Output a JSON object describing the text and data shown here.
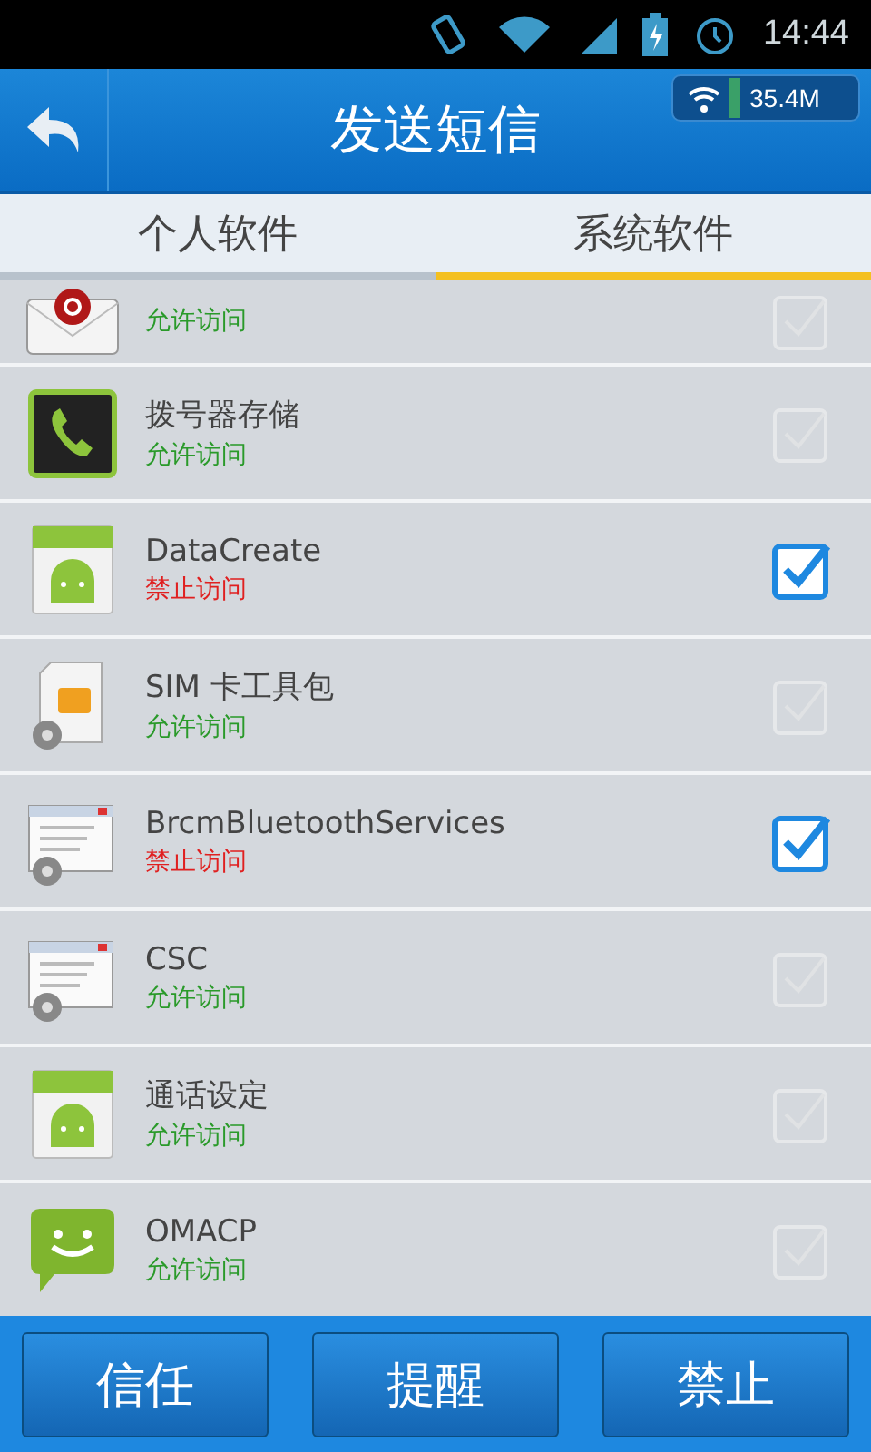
{
  "status_bar": {
    "time": "14:44"
  },
  "header": {
    "title": "发送短信",
    "traffic": "35.4M"
  },
  "tabs": [
    {
      "label": "个人软件",
      "selected": false
    },
    {
      "label": "系统软件",
      "selected": true
    }
  ],
  "apps": [
    {
      "kind": "email",
      "status": {
        "text": "允许访问",
        "kind": "allow"
      },
      "checked": false
    },
    {
      "kind": "dialer",
      "name": "拨号器存储",
      "status": {
        "text": "允许访问",
        "kind": "allow"
      },
      "checked": false
    },
    {
      "kind": "android",
      "name": "DataCreate",
      "status": {
        "text": "禁止访问",
        "kind": "deny"
      },
      "checked": true
    },
    {
      "kind": "sim",
      "name": "SIM 卡工具包",
      "status": {
        "text": "允许访问",
        "kind": "allow"
      },
      "checked": false
    },
    {
      "kind": "window",
      "name": "BrcmBluetoothServices",
      "status": {
        "text": "禁止访问",
        "kind": "deny"
      },
      "checked": true
    },
    {
      "kind": "window",
      "name": "CSC",
      "status": {
        "text": "允许访问",
        "kind": "allow"
      },
      "checked": false
    },
    {
      "kind": "android",
      "name": "通话设定",
      "status": {
        "text": "允许访问",
        "kind": "allow"
      },
      "checked": false
    },
    {
      "kind": "sms",
      "name": "OMACP",
      "status": {
        "text": "允许访问",
        "kind": "allow"
      },
      "checked": false
    }
  ],
  "buttons": [
    "信任",
    "提醒",
    "禁止"
  ]
}
